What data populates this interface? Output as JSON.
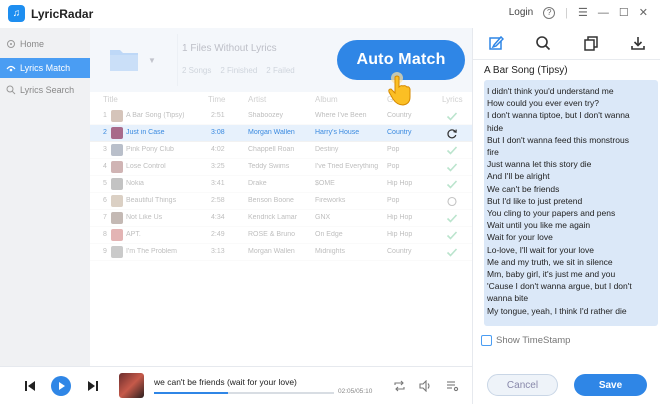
{
  "app": {
    "title": "LyricRadar"
  },
  "window": {
    "login_label": "Login"
  },
  "sidebar": {
    "items": [
      {
        "label": "Home",
        "active": false
      },
      {
        "label": "Lyrics Match",
        "active": true
      },
      {
        "label": "Lyrics Search",
        "active": false
      }
    ]
  },
  "header": {
    "summary": "1 Files Without Lyrics",
    "stats": [
      "2 Songs",
      "2 Finished",
      "2 Failed"
    ],
    "auto_match_label": "Auto Match"
  },
  "table": {
    "columns": [
      "Title",
      "Time",
      "Artist",
      "Album",
      "Genre",
      "Lyrics"
    ],
    "rows": [
      {
        "num": "1",
        "title": "A Bar Song (Tipsy)",
        "time": "2:51",
        "artist": "Shaboozey",
        "album": "Where I've Been",
        "genre": "Country",
        "lyrics": "check",
        "thumb": "#8a5a3c",
        "selected": false
      },
      {
        "num": "2",
        "title": "Just in Case",
        "time": "3:08",
        "artist": "Morgan Wallen",
        "album": "Harry's House",
        "genre": "Country",
        "lyrics": "refresh",
        "thumb": "#a86a8a",
        "selected": true
      },
      {
        "num": "3",
        "title": "Pink Pony Club",
        "time": "4:02",
        "artist": "Chappell Roan",
        "album": "Destiny",
        "genre": "Pop",
        "lyrics": "check",
        "thumb": "#3a4a6a",
        "selected": false
      },
      {
        "num": "4",
        "title": "Lose Control",
        "time": "3:25",
        "artist": "Teddy Swims",
        "album": "I've Tried Everything",
        "genre": "Pop",
        "lyrics": "check",
        "thumb": "#7a2a2a",
        "selected": false
      },
      {
        "num": "5",
        "title": "Nokia",
        "time": "3:41",
        "artist": "Drake",
        "album": "$OME",
        "genre": "Hip Hop",
        "lyrics": "check",
        "thumb": "#555555",
        "selected": false
      },
      {
        "num": "6",
        "title": "Beautiful Things",
        "time": "2:58",
        "artist": "Benson Boone",
        "album": "Fireworks",
        "genre": "Pop",
        "lyrics": "clock",
        "thumb": "#9a7a5a",
        "selected": false
      },
      {
        "num": "7",
        "title": "Not Like Us",
        "time": "4:34",
        "artist": "Kendrick Lamar",
        "album": "GNX",
        "genre": "Hip Hop",
        "lyrics": "check",
        "thumb": "#5a3a2a",
        "selected": false
      },
      {
        "num": "8",
        "title": "APT.",
        "time": "2:49",
        "artist": "ROSE & Bruno",
        "album": "On Edge",
        "genre": "Hip Hop",
        "lyrics": "check",
        "thumb": "#b02a2a",
        "selected": false
      },
      {
        "num": "9",
        "title": "I'm The Problem",
        "time": "3:13",
        "artist": "Morgan Wallen",
        "album": "Midnights",
        "genre": "Country",
        "lyrics": "check",
        "thumb": "#6a6a6a",
        "selected": false
      }
    ]
  },
  "panel": {
    "tools": [
      "edit-icon",
      "search-icon",
      "copy-icon",
      "download-icon"
    ],
    "song_title": "A Bar Song (Tipsy)",
    "lyrics": [
      "I didn't think you'd understand me",
      "How could you ever even try?",
      "I don't wanna tiptoe, but I don't wanna",
      "hide",
      "But I don't wanna feed this monstrous",
      "fire",
      "Just wanna let this story die",
      "And I'll be alright",
      "We can't be friends",
      "But I'd like to just pretend",
      "You cling to your papers and pens",
      "Wait until you like me again",
      "Wait for your love",
      "Lo-love, I'll wait for your love",
      "Me and my truth, we sit in silence",
      "Mm, baby girl, it's just me and you",
      "'Cause I don't wanna argue, but I don't",
      "wanna bite",
      "My tongue, yeah, I think I'd rather die"
    ],
    "show_timestamp_label": "Show TimeStamp",
    "cancel_label": "Cancel",
    "save_label": "Save"
  },
  "player": {
    "now_playing": "we can't be friends (wait for your love)",
    "time": "02:05/05:10",
    "progress": 0.41
  },
  "colors": {
    "accent": "#2f86e6",
    "sidebar_active": "#4a9df3",
    "check": "#3cb371"
  }
}
